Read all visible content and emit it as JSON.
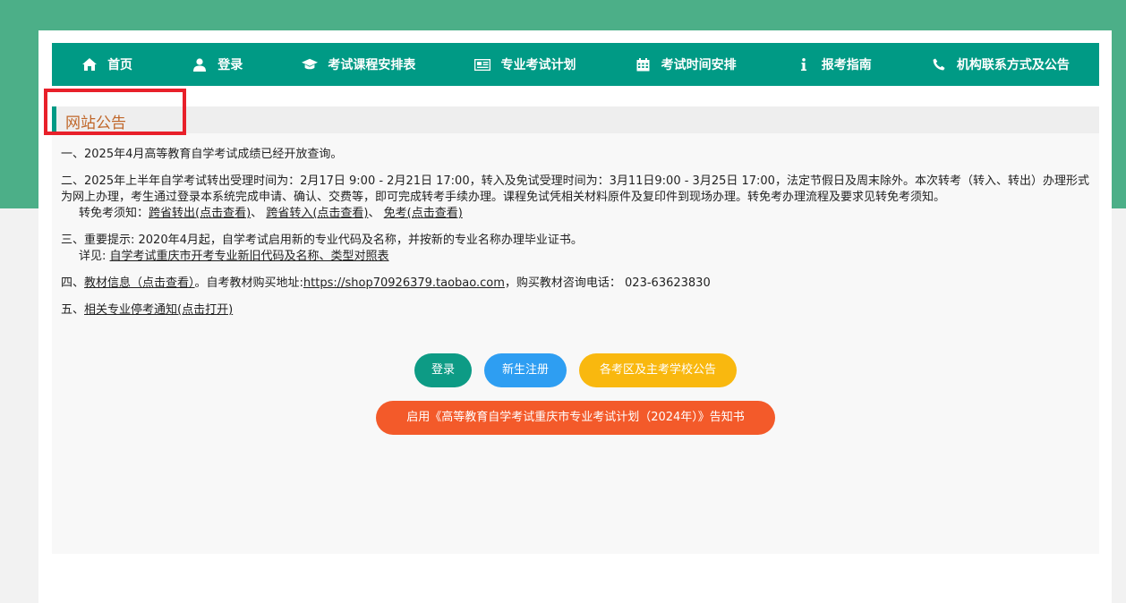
{
  "colors": {
    "brand_green": "#4caf88",
    "nav_teal": "#009a85",
    "title_orange": "#c0672a",
    "highlight_red": "#e8202a",
    "btn_login": "#0d9b85",
    "btn_register": "#2e9ef2",
    "btn_notice": "#f9b80f",
    "btn_plan": "#f35a2a"
  },
  "nav": {
    "items": [
      {
        "icon": "home-icon",
        "label": "首页"
      },
      {
        "icon": "user-icon",
        "label": "登录"
      },
      {
        "icon": "graduation-cap-icon",
        "label": "考试课程安排表"
      },
      {
        "icon": "newspaper-icon",
        "label": "专业考试计划"
      },
      {
        "icon": "calendar-icon",
        "label": "考试时间安排"
      },
      {
        "icon": "info-icon",
        "label": "报考指南"
      },
      {
        "icon": "phone-icon",
        "label": "机构联系方式及公告"
      }
    ]
  },
  "notice": {
    "title": "网站公告",
    "item1": {
      "text": "一、2025年4月高等教育自学考试成绩已经开放查询。"
    },
    "item2": {
      "text": "二、2025年上半年自学考试转出受理时间为：2月17日 9:00 - 2月21日 17:00，转入及免试受理时间为：3月11日9:00 - 3月25日 17:00，法定节假日及周末除外。本次转考（转入、转出）办理形式为网上办理，考生通过登录本系统完成申请、确认、交费等，即可完成转考手续办理。课程免试凭相关材料原件及复印件到现场办理。转免考办理流程及要求见转免考须知。",
      "sub_prefix": "转免考须知：",
      "link1": "跨省转出(点击查看)",
      "sep1": "、",
      "link2": "跨省转入(点击查看)",
      "sep2": "、",
      "link3": "免考(点击查看)"
    },
    "item3": {
      "text": "三、重要提示: 2020年4月起，自学考试启用新的专业代码及名称，并按新的专业名称办理毕业证书。",
      "sub_prefix": "详见: ",
      "link": "自学考试重庆市开考专业新旧代码及名称、类型对照表"
    },
    "item4": {
      "prefix": "四、",
      "link": "教材信息（点击查看）",
      "mid": "。自考教材购买地址:",
      "url": "https://shop70926379.taobao.com",
      "suffix": "，购买教材咨询电话： 023-63623830"
    },
    "item5": {
      "prefix": "五、",
      "link": "相关专业停考通知(点击打开)"
    }
  },
  "buttons": {
    "login": "登录",
    "register": "新生注册",
    "exam_notice": "各考区及主考学校公告",
    "plan_notice": "启用《高等教育自学考试重庆市专业考试计划（2024年）》告知书"
  }
}
